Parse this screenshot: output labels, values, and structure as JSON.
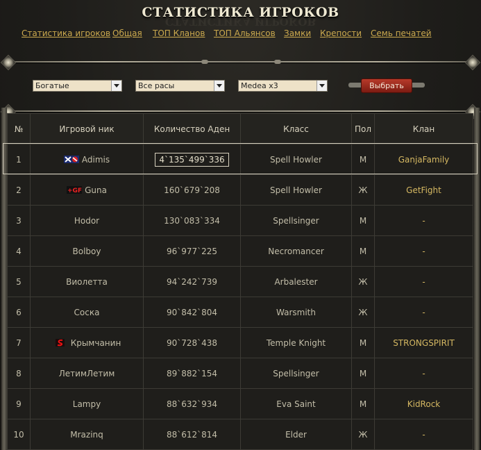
{
  "page": {
    "title": "СТАТИСТИКА ИГРОКОВ"
  },
  "nav": {
    "items": [
      {
        "label": "Статистика игроков"
      },
      {
        "label": "Общая"
      },
      {
        "label": "ТОП Кланов"
      },
      {
        "label": "ТОП Альянсов"
      },
      {
        "label": "Замки"
      },
      {
        "label": "Крепости"
      },
      {
        "label": "Семь печатей"
      }
    ]
  },
  "filters": {
    "category": "Богатые",
    "race": "Все расы",
    "server": "Medea x3",
    "submit_label": "Выбрать"
  },
  "table": {
    "headers": {
      "num": "№",
      "nick": "Игровой ник",
      "amount": "Количество Аден",
      "class": "Класс",
      "gender": "Пол",
      "clan": "Клан"
    },
    "rows": [
      {
        "num": "1",
        "nick": "Adimis",
        "amount": "4`135`499`336",
        "class": "Spell Howler",
        "gender": "М",
        "clan": "GanjaFamily",
        "icon": "clan-crest-icon"
      },
      {
        "num": "2",
        "nick": "Guna",
        "amount": "160`679`208",
        "class": "Spell Howler",
        "gender": "Ж",
        "clan": "GetFight",
        "icon": "clan-crest-icon"
      },
      {
        "num": "3",
        "nick": "Hodor",
        "amount": "130`083`334",
        "class": "Spellsinger",
        "gender": "М",
        "clan": "-"
      },
      {
        "num": "4",
        "nick": "Bolboy",
        "amount": "96`977`225",
        "class": "Necromancer",
        "gender": "М",
        "clan": "-"
      },
      {
        "num": "5",
        "nick": "Виолетта",
        "amount": "94`242`739",
        "class": "Arbalester",
        "gender": "Ж",
        "clan": "-"
      },
      {
        "num": "6",
        "nick": "Соска",
        "amount": "90`842`804",
        "class": "Warsmith",
        "gender": "Ж",
        "clan": "-"
      },
      {
        "num": "7",
        "nick": "Крымчанин",
        "amount": "90`728`438",
        "class": "Temple Knight",
        "gender": "М",
        "clan": "STRONGSPIRIT",
        "icon": "clan-crest-icon"
      },
      {
        "num": "8",
        "nick": "ЛетимЛетим",
        "amount": "89`882`154",
        "class": "Spellsinger",
        "gender": "М",
        "clan": "-"
      },
      {
        "num": "9",
        "nick": "Lampy",
        "amount": "88`632`934",
        "class": "Eva Saint",
        "gender": "М",
        "clan": "KidRock"
      },
      {
        "num": "10",
        "nick": "Mrazinq",
        "amount": "88`612`814",
        "class": "Elder",
        "gender": "Ж",
        "clan": "-"
      }
    ]
  }
}
